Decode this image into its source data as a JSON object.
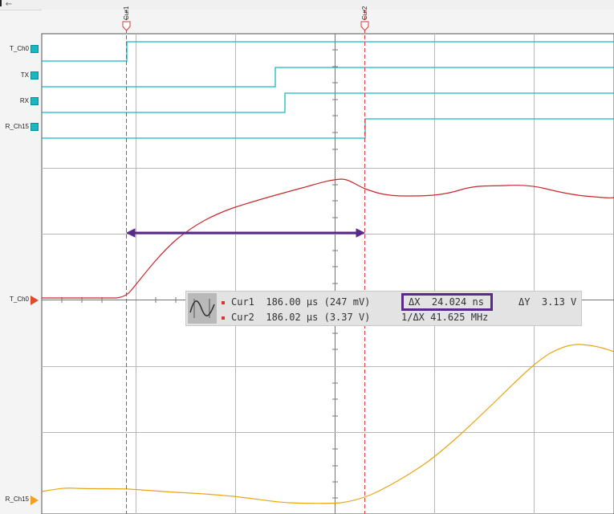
{
  "toolbar": {
    "back_icon": "arrow-left-icon"
  },
  "cursors": [
    {
      "label": "Cur1",
      "time_us": 186.0
    },
    {
      "label": "Cur2",
      "time_us": 186.02
    }
  ],
  "channels": [
    {
      "label": "T_Ch0",
      "kind": "digital"
    },
    {
      "label": "TX",
      "kind": "digital"
    },
    {
      "label": "RX",
      "kind": "digital"
    },
    {
      "label": "R_Ch15",
      "kind": "digital"
    },
    {
      "label": "T_Ch0",
      "kind": "analog",
      "color": "#e04a2a"
    },
    {
      "label": "R_Ch15",
      "kind": "analog",
      "color": "#f0a020"
    }
  ],
  "colors": {
    "digital": "#19b7c0",
    "analog_red": "#c8282c",
    "analog_yellow": "#e8a614",
    "cursor": "#d63c3c",
    "measure_arrow": "#5a2a8a"
  },
  "readout": {
    "cur1_label": "Cur1",
    "cur1_value": "186.00 µs (247 mV)",
    "cur2_label": "Cur2",
    "cur2_value": "186.02 µs (3.37 V)",
    "dx_label": "ΔX",
    "dx_value": "24.024 ns",
    "inv_dx_label": "1/ΔX",
    "inv_dx_value": "41.625 MHz",
    "dy_label": "ΔY",
    "dy_value": "3.13 V"
  }
}
